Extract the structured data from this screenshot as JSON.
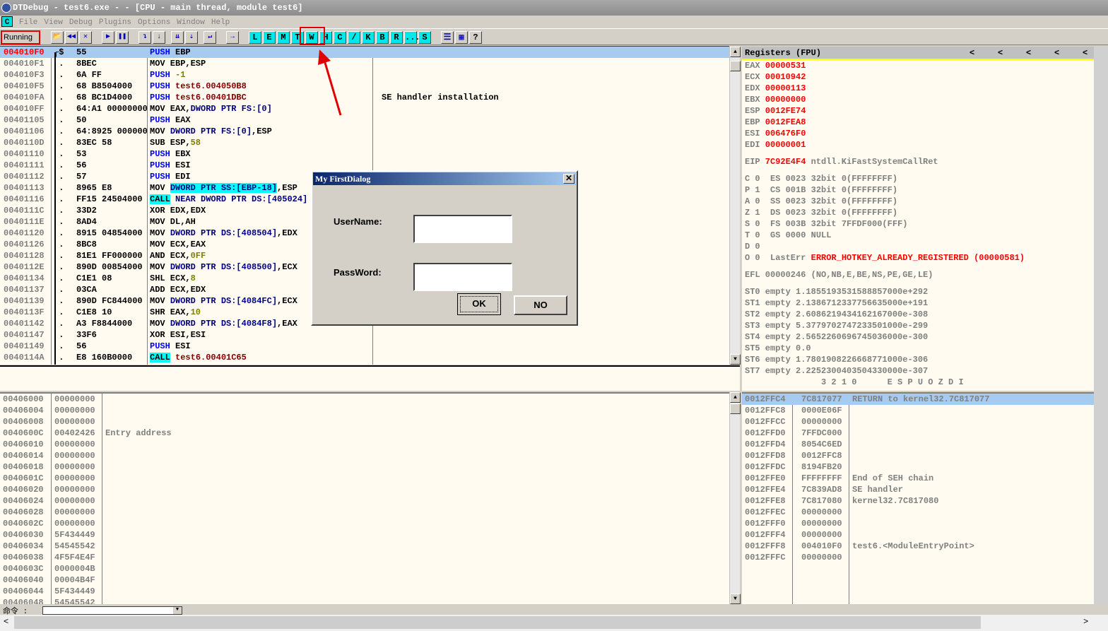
{
  "window": {
    "title": "DTDebug - test6.exe - - [CPU - main thread, module test6]"
  },
  "menu": {
    "c_label": "C",
    "items": [
      "File",
      "View",
      "Debug",
      "Plugins",
      "Options",
      "Window",
      "Help"
    ]
  },
  "toolbar": {
    "status": "Running",
    "icons": [
      "open-icon",
      "restart-icon",
      "close-icon",
      "run-icon",
      "pause-icon",
      "step-into-icon",
      "step-over-icon",
      "trace-into-icon",
      "trace-over-icon",
      "execute-till-return-icon",
      "go-to-icon"
    ],
    "letters": [
      "L",
      "E",
      "M",
      "T",
      "W",
      "H",
      "C",
      "/",
      "K",
      "B",
      "R",
      "...",
      "S"
    ],
    "right_icons": [
      "list-icon",
      "colors-icon",
      "help-icon"
    ],
    "help_label": "?",
    "highlight_color": "#e00000"
  },
  "disasm": {
    "rows": [
      {
        "addr": "004010F0",
        "mark": "┌$",
        "hex": "55",
        "seg": [
          [
            "PUSH",
            "kw"
          ],
          [
            " EBP",
            "blk"
          ]
        ],
        "current": true
      },
      {
        "addr": "004010F1",
        "mark": " .",
        "hex": "8BEC",
        "seg": [
          [
            "MOV EBP,ESP",
            "blk"
          ]
        ]
      },
      {
        "addr": "004010F3",
        "mark": " .",
        "hex": "6A FF",
        "seg": [
          [
            "PUSH",
            "kw"
          ],
          [
            " ",
            "blk"
          ],
          [
            "-1",
            "num"
          ]
        ]
      },
      {
        "addr": "004010F5",
        "mark": " .",
        "hex": "68 B8504000",
        "seg": [
          [
            "PUSH",
            "kw"
          ],
          [
            " ",
            "blk"
          ],
          [
            "test6.004050B8",
            "lbl"
          ]
        ]
      },
      {
        "addr": "004010FA",
        "mark": " .",
        "hex": "68 BC1D4000",
        "seg": [
          [
            "PUSH",
            "kw"
          ],
          [
            " ",
            "blk"
          ],
          [
            "test6.00401DBC",
            "lbl"
          ]
        ],
        "comment": "SE handler installation"
      },
      {
        "addr": "004010FF",
        "mark": " .",
        "hex": "64:A1 00000000",
        "seg": [
          [
            "MOV EAX,",
            "blk"
          ],
          [
            "DWORD PTR FS:[0]",
            "ptr"
          ]
        ]
      },
      {
        "addr": "00401105",
        "mark": " .",
        "hex": "50",
        "seg": [
          [
            "PUSH",
            "kw"
          ],
          [
            " EAX",
            "blk"
          ]
        ]
      },
      {
        "addr": "00401106",
        "mark": " .",
        "hex": "64:8925 00000000",
        "seg": [
          [
            "MOV ",
            "blk"
          ],
          [
            "DWORD PTR FS:[0]",
            "ptr"
          ],
          [
            ",ESP",
            "blk"
          ]
        ]
      },
      {
        "addr": "0040110D",
        "mark": " .",
        "hex": "83EC 58",
        "seg": [
          [
            "SUB ESP,",
            "blk"
          ],
          [
            "58",
            "num"
          ]
        ]
      },
      {
        "addr": "00401110",
        "mark": " .",
        "hex": "53",
        "seg": [
          [
            "PUSH",
            "kw"
          ],
          [
            " EBX",
            "blk"
          ]
        ]
      },
      {
        "addr": "00401111",
        "mark": " .",
        "hex": "56",
        "seg": [
          [
            "PUSH",
            "kw"
          ],
          [
            " ESI",
            "blk"
          ]
        ]
      },
      {
        "addr": "00401112",
        "mark": " .",
        "hex": "57",
        "seg": [
          [
            "PUSH",
            "kw"
          ],
          [
            " EDI",
            "blk"
          ]
        ]
      },
      {
        "addr": "00401113",
        "mark": " .",
        "hex": "8965 E8",
        "seg": [
          [
            "MOV ",
            "blk"
          ],
          [
            "DWORD PTR SS:[EBP-18]",
            "ptr hl"
          ],
          [
            ",ESP",
            "blk"
          ]
        ]
      },
      {
        "addr": "00401116",
        "mark": " .",
        "hex": "FF15 24504000",
        "seg": [
          [
            "CALL",
            "blk hl"
          ],
          [
            " NEAR DWORD PTR DS:[405024]",
            "ptr"
          ]
        ]
      },
      {
        "addr": "0040111C",
        "mark": " .",
        "hex": "33D2",
        "seg": [
          [
            "XOR EDX,EDX",
            "blk"
          ]
        ]
      },
      {
        "addr": "0040111E",
        "mark": " .",
        "hex": "8AD4",
        "seg": [
          [
            "MOV DL,AH",
            "blk"
          ]
        ]
      },
      {
        "addr": "00401120",
        "mark": " .",
        "hex": "8915 04854000",
        "seg": [
          [
            "MOV ",
            "blk"
          ],
          [
            "DWORD PTR DS:[408504]",
            "ptr"
          ],
          [
            ",EDX",
            "blk"
          ]
        ]
      },
      {
        "addr": "00401126",
        "mark": " .",
        "hex": "8BC8",
        "seg": [
          [
            "MOV ECX,EAX",
            "blk"
          ]
        ]
      },
      {
        "addr": "00401128",
        "mark": " .",
        "hex": "81E1 FF000000",
        "seg": [
          [
            "AND ECX,",
            "blk"
          ],
          [
            "0FF",
            "num"
          ]
        ]
      },
      {
        "addr": "0040112E",
        "mark": " .",
        "hex": "890D 00854000",
        "seg": [
          [
            "MOV ",
            "blk"
          ],
          [
            "DWORD PTR DS:[408500]",
            "ptr"
          ],
          [
            ",ECX",
            "blk"
          ]
        ]
      },
      {
        "addr": "00401134",
        "mark": " .",
        "hex": "C1E1 08",
        "seg": [
          [
            "SHL ECX,",
            "blk"
          ],
          [
            "8",
            "num"
          ]
        ]
      },
      {
        "addr": "00401137",
        "mark": " .",
        "hex": "03CA",
        "seg": [
          [
            "ADD ECX,EDX",
            "blk"
          ]
        ]
      },
      {
        "addr": "00401139",
        "mark": " .",
        "hex": "890D FC844000",
        "seg": [
          [
            "MOV ",
            "blk"
          ],
          [
            "DWORD PTR DS:[4084FC]",
            "ptr"
          ],
          [
            ",ECX",
            "blk"
          ]
        ]
      },
      {
        "addr": "0040113F",
        "mark": " .",
        "hex": "C1E8 10",
        "seg": [
          [
            "SHR EAX,",
            "blk"
          ],
          [
            "10",
            "num"
          ]
        ]
      },
      {
        "addr": "00401142",
        "mark": " .",
        "hex": "A3 F8844000",
        "seg": [
          [
            "MOV ",
            "blk"
          ],
          [
            "DWORD PTR DS:[4084F8]",
            "ptr"
          ],
          [
            ",EAX",
            "blk"
          ]
        ]
      },
      {
        "addr": "00401147",
        "mark": " .",
        "hex": "33F6",
        "seg": [
          [
            "XOR ESI,ESI",
            "blk"
          ]
        ]
      },
      {
        "addr": "00401149",
        "mark": " .",
        "hex": "56",
        "seg": [
          [
            "PUSH",
            "kw"
          ],
          [
            " ESI",
            "blk"
          ]
        ]
      },
      {
        "addr": "0040114A",
        "mark": " .",
        "hex": "E8 160B0000",
        "seg": [
          [
            "CALL",
            "blk hl"
          ],
          [
            " ",
            "blk"
          ],
          [
            "test6.00401C65",
            "lbl"
          ]
        ]
      }
    ]
  },
  "registers": {
    "title": "Registers (FPU)",
    "nav": [
      "<",
      "<",
      "<",
      "<",
      "<"
    ],
    "gp": [
      [
        "EAX",
        "00000531"
      ],
      [
        "ECX",
        "00010942"
      ],
      [
        "EDX",
        "00000113"
      ],
      [
        "EBX",
        "00000000"
      ],
      [
        "ESP",
        "0012FE74"
      ],
      [
        "EBP",
        "0012FEA8"
      ],
      [
        "ESI",
        "006476F0"
      ],
      [
        "EDI",
        "00000001"
      ]
    ],
    "eip": {
      "name": "EIP",
      "value": "7C92E4F4",
      "label": "ntdll.KiFastSystemCallRet"
    },
    "flags": [
      "C 0  ES 0023 32bit 0(FFFFFFFF)",
      "P 1  CS 001B 32bit 0(FFFFFFFF)",
      "A 0  SS 0023 32bit 0(FFFFFFFF)",
      "Z 1  DS 0023 32bit 0(FFFFFFFF)",
      "S 0  FS 003B 32bit 7FFDF000(FFF)",
      "T 0  GS 0000 NULL",
      "D 0"
    ],
    "lasterr": {
      "prefix": "O 0  LastErr ",
      "value": "ERROR_HOTKEY_ALREADY_REGISTERED (00000581)"
    },
    "efl": "EFL 00000246 (NO,NB,E,BE,NS,PE,GE,LE)",
    "fpu": [
      "ST0 empty 1.1855193531588857000e+292",
      "ST1 empty 2.1386712337756635000e+191",
      "ST2 empty 2.6086219434162167000e-308",
      "ST3 empty 5.3779702747233501000e-299",
      "ST4 empty 2.5652260696745036000e-300",
      "ST5 empty 0.0",
      "ST6 empty 1.7801908226668771000e-306",
      "ST7 empty 2.2252300403504330000e-307"
    ],
    "fpu_footer": "               3 2 1 0      E S P U O Z D I"
  },
  "dump": {
    "rows": [
      [
        "00406000",
        "00000000",
        ""
      ],
      [
        "00406004",
        "00000000",
        ""
      ],
      [
        "00406008",
        "00000000",
        ""
      ],
      [
        "0040600C",
        "00402426",
        "Entry address"
      ],
      [
        "00406010",
        "00000000",
        ""
      ],
      [
        "00406014",
        "00000000",
        ""
      ],
      [
        "00406018",
        "00000000",
        ""
      ],
      [
        "0040601C",
        "00000000",
        ""
      ],
      [
        "00406020",
        "00000000",
        ""
      ],
      [
        "00406024",
        "00000000",
        ""
      ],
      [
        "00406028",
        "00000000",
        ""
      ],
      [
        "0040602C",
        "00000000",
        ""
      ],
      [
        "00406030",
        "5F434449",
        ""
      ],
      [
        "00406034",
        "54545542",
        ""
      ],
      [
        "00406038",
        "4F5F4E4F",
        ""
      ],
      [
        "0040603C",
        "0000004B",
        ""
      ],
      [
        "00406040",
        "00004B4F",
        ""
      ],
      [
        "00406044",
        "5F434449",
        ""
      ],
      [
        "00406048",
        "54545542",
        ""
      ]
    ]
  },
  "stack": {
    "rows": [
      [
        "0012FFC4",
        "7C817077",
        "RETURN to kernel32.7C817077"
      ],
      [
        "0012FFC8",
        "0000E06F",
        ""
      ],
      [
        "0012FFCC",
        "00000000",
        ""
      ],
      [
        "0012FFD0",
        "7FFDC000",
        ""
      ],
      [
        "0012FFD4",
        "8054C6ED",
        ""
      ],
      [
        "0012FFD8",
        "0012FFC8",
        ""
      ],
      [
        "0012FFDC",
        "8194FB20",
        ""
      ],
      [
        "0012FFE0",
        "FFFFFFFF",
        "End of SEH chain"
      ],
      [
        "0012FFE4",
        "7C839AD8",
        "SE handler"
      ],
      [
        "0012FFE8",
        "7C817080",
        "kernel32.7C817080"
      ],
      [
        "0012FFEC",
        "00000000",
        ""
      ],
      [
        "0012FFF0",
        "00000000",
        ""
      ],
      [
        "0012FFF4",
        "00000000",
        ""
      ],
      [
        "0012FFF8",
        "004010F0",
        "test6.<ModuleEntryPoint>"
      ],
      [
        "0012FFFC",
        "00000000",
        ""
      ]
    ]
  },
  "command": {
    "label": "命令 :",
    "value": ""
  },
  "dialog": {
    "title": "My FirstDialog",
    "close": "✕",
    "username_label": "UserName:",
    "password_label": "PassWord:",
    "username_value": "",
    "password_value": "",
    "ok": "OK",
    "no": "NO"
  }
}
